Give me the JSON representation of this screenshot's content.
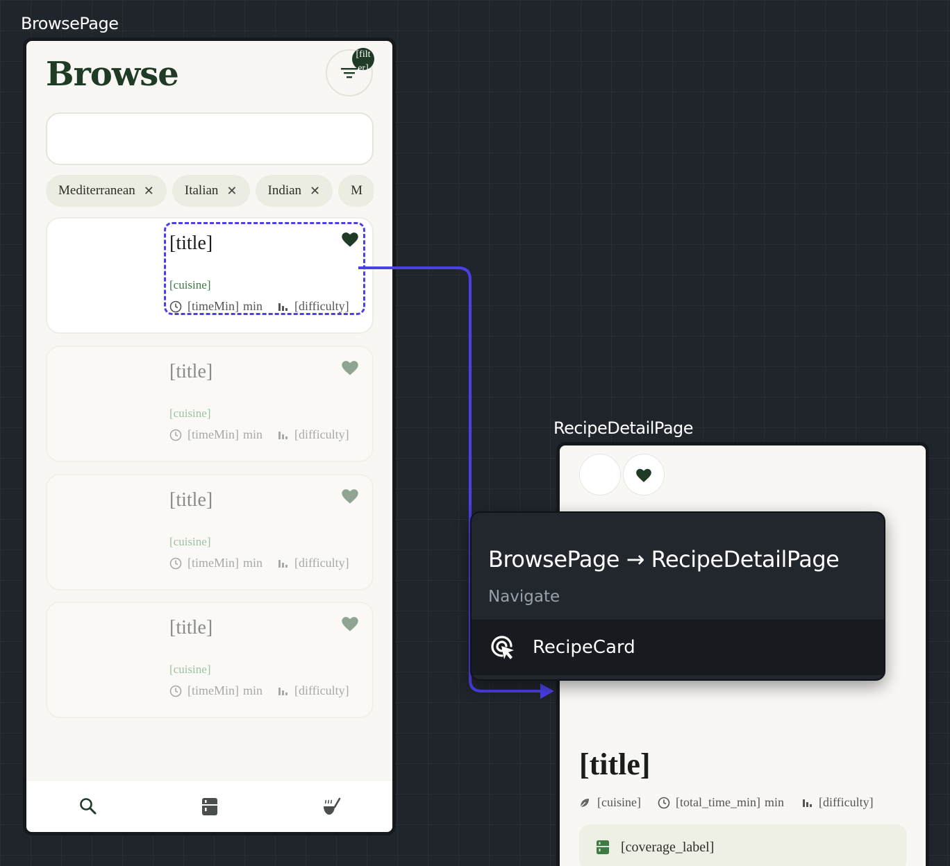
{
  "frames": {
    "browse_label": "BrowsePage",
    "detail_label": "RecipeDetailPage"
  },
  "browse": {
    "title": "Browse",
    "filter_badge": "[filt\ner]",
    "search_placeholder": "",
    "chips": [
      {
        "label": "Mediterranean",
        "remove": "✕"
      },
      {
        "label": "Italian",
        "remove": "✕"
      },
      {
        "label": "Indian",
        "remove": "✕"
      },
      {
        "label": "M",
        "remove": ""
      }
    ],
    "cards": [
      {
        "title": "[title]",
        "cuisine": "[cuisine]",
        "time": "[timeMin]",
        "time_unit": "min",
        "difficulty": "[difficulty]"
      },
      {
        "title": "[title]",
        "cuisine": "[cuisine]",
        "time": "[timeMin]",
        "time_unit": "min",
        "difficulty": "[difficulty]"
      },
      {
        "title": "[title]",
        "cuisine": "[cuisine]",
        "time": "[timeMin]",
        "time_unit": "min",
        "difficulty": "[difficulty]"
      },
      {
        "title": "[title]",
        "cuisine": "[cuisine]",
        "time": "[timeMin]",
        "time_unit": "min",
        "difficulty": "[difficulty]"
      }
    ],
    "nav": [
      "search-icon",
      "fridge-icon",
      "cooking-pot-icon"
    ]
  },
  "detail": {
    "title": "[title]",
    "cuisine": "[cuisine]",
    "time": "[total_time_min]",
    "time_unit": "min",
    "difficulty": "[difficulty]",
    "coverage": "[coverage_label]"
  },
  "transition": {
    "title": "BrowsePage → RecipeDetailPage",
    "action": "Navigate",
    "trigger": "RecipeCard"
  },
  "colors": {
    "accent": "#4b3fe6",
    "brand_dark": "#1f3a25",
    "canvas": "#20252b"
  }
}
